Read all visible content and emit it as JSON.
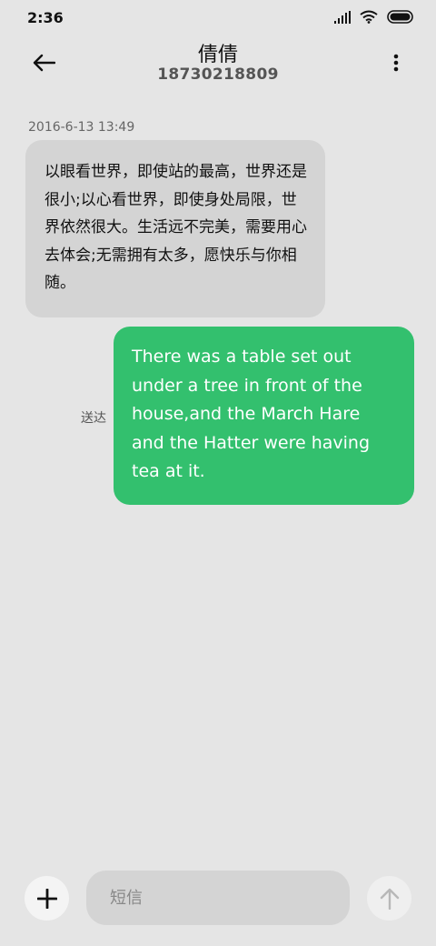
{
  "status_bar": {
    "time": "2:36"
  },
  "header": {
    "contact_name": "倩倩",
    "contact_number": "18730218809"
  },
  "conversation": {
    "timestamp": "2016-6-13 13:49",
    "incoming_message": "以眼看世界，即使站的最高，世界还是很小;以心看世界，即使身处局限，世界依然很大。生活远不完美，需要用心去体会;无需拥有太多，愿快乐与你相随。",
    "outgoing_message": "There was a table set out under a tree in front of the house,and the March Hare and the Hatter were having tea at it.",
    "outgoing_status": "送达"
  },
  "composer": {
    "placeholder": "短信"
  },
  "colors": {
    "background": "#e5e5e5",
    "incoming_bubble": "#d4d4d4",
    "outgoing_bubble": "#33c06e"
  }
}
